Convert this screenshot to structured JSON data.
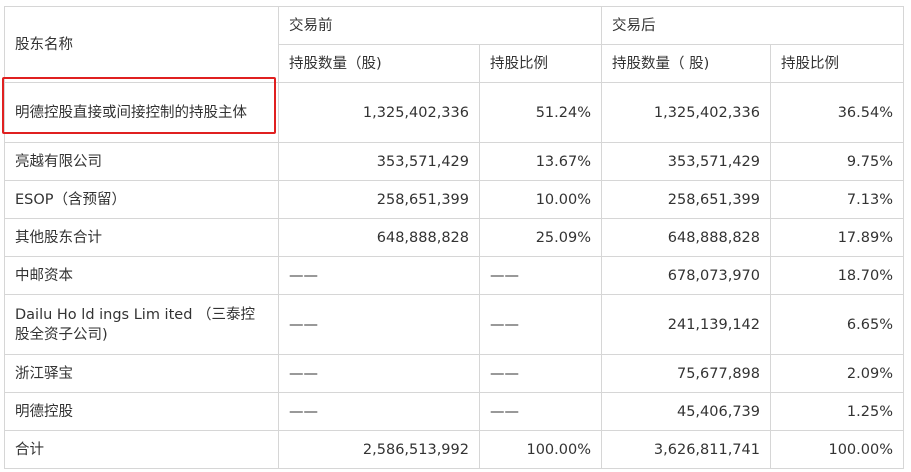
{
  "table": {
    "name_header": "股东名称",
    "before_group": "交易前",
    "after_group": "交易后",
    "shares_header": "持股数量（股)",
    "ratio_header": "持股比例",
    "shares_header_after": "持股数量（ 股)",
    "ratio_header_after": "持股比例",
    "rows": [
      {
        "name": "明德控股直接或间接控制的持股主体",
        "before_shares": "1,325,402,336",
        "before_ratio": "51.24%",
        "after_shares": "1,325,402,336",
        "after_ratio": "36.54%"
      },
      {
        "name": "亮越有限公司",
        "before_shares": "353,571,429",
        "before_ratio": "13.67%",
        "after_shares": "353,571,429",
        "after_ratio": "9.75%"
      },
      {
        "name": "ESOP（含预留）",
        "before_shares": "258,651,399",
        "before_ratio": "10.00%",
        "after_shares": "258,651,399",
        "after_ratio": "7.13%"
      },
      {
        "name": "其他股东合计",
        "before_shares": "648,888,828",
        "before_ratio": "25.09%",
        "after_shares": "648,888,828",
        "after_ratio": "17.89%"
      },
      {
        "name": "中邮资本",
        "before_shares": "——",
        "before_ratio": "——",
        "after_shares": "678,073,970",
        "after_ratio": "18.70%"
      },
      {
        "name": "Dailu Ho ld ings Lim ited （三泰控股全资子公司)",
        "before_shares": "——",
        "before_ratio": "——",
        "after_shares": "241,139,142",
        "after_ratio": "6.65%"
      },
      {
        "name": "浙江驿宝",
        "before_shares": "——",
        "before_ratio": "——",
        "after_shares": "75,677,898",
        "after_ratio": "2.09%"
      },
      {
        "name": "明德控股",
        "before_shares": "——",
        "before_ratio": "——",
        "after_shares": "45,406,739",
        "after_ratio": "1.25%"
      },
      {
        "name": "合计",
        "before_shares": "2,586,513,992",
        "before_ratio": "100.00%",
        "after_shares": "3,626,811,741",
        "after_ratio": "100.00%"
      }
    ]
  },
  "highlight": {
    "color": "#e02020"
  }
}
